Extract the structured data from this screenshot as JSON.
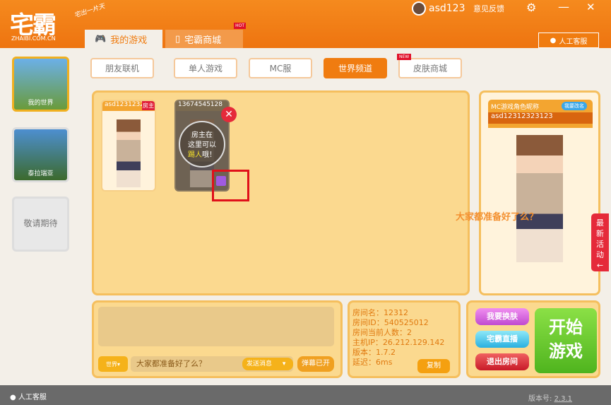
{
  "header": {
    "logo": "宅霸",
    "logo_sub": "ZHAIBI.COM.CN",
    "slogan": "宅出一片天",
    "username": "asd123",
    "feedback": "意见反馈",
    "service": "人工客服",
    "hot_badge": "HOT",
    "tabs": [
      {
        "label": "我的游戏",
        "icon": "gamepad-icon"
      },
      {
        "label": "宅霸商城",
        "icon": "bag-icon"
      }
    ]
  },
  "sidebar": {
    "games": [
      {
        "label": "我的世界"
      },
      {
        "label": "泰拉瑞亚"
      },
      {
        "label": "敬请期待"
      }
    ]
  },
  "subtabs": [
    {
      "label": "朋友联机"
    },
    {
      "label": "单人游戏"
    },
    {
      "label": "MC服"
    },
    {
      "label": "世界频道",
      "active": true
    },
    {
      "label": "皮肤商城",
      "badge": "NEW"
    }
  ],
  "room": {
    "players": [
      {
        "name": "asd12312323",
        "host_badge": "房主"
      },
      {
        "name": "13674545128"
      }
    ],
    "bubble_line1": "房主在",
    "bubble_line2": "这里可以",
    "bubble_hl": "踢人",
    "bubble_end": "哦！"
  },
  "profile": {
    "nick_label": "MC游戏角色昵称",
    "rename": "我要改名",
    "nick": "asd12312323123"
  },
  "danmaku": "大家都准备好了么？",
  "activity": [
    "最",
    "新",
    "活",
    "动",
    "←"
  ],
  "chat": {
    "channel": "世界",
    "input": "大家都准备好了么？",
    "send": "发送消息",
    "danmu": "弹幕已开"
  },
  "info": {
    "lines": [
      "房间名：12312",
      "房间ID：540525012",
      "房间当前人数：2",
      "主机IP：26.212.129.142",
      "版本：1.7.2",
      "延迟：6ms"
    ],
    "copy": "复制"
  },
  "actions": {
    "skin": "我要换肤",
    "live": "宅霸直播",
    "exit": "退出房间",
    "start1": "开始",
    "start2": "游戏"
  },
  "footer": {
    "service": "人工客服",
    "version_label": "版本号:",
    "version": "2.3.1"
  },
  "colors": {
    "brand": "#f07c10",
    "highlight": "#e0101a"
  }
}
